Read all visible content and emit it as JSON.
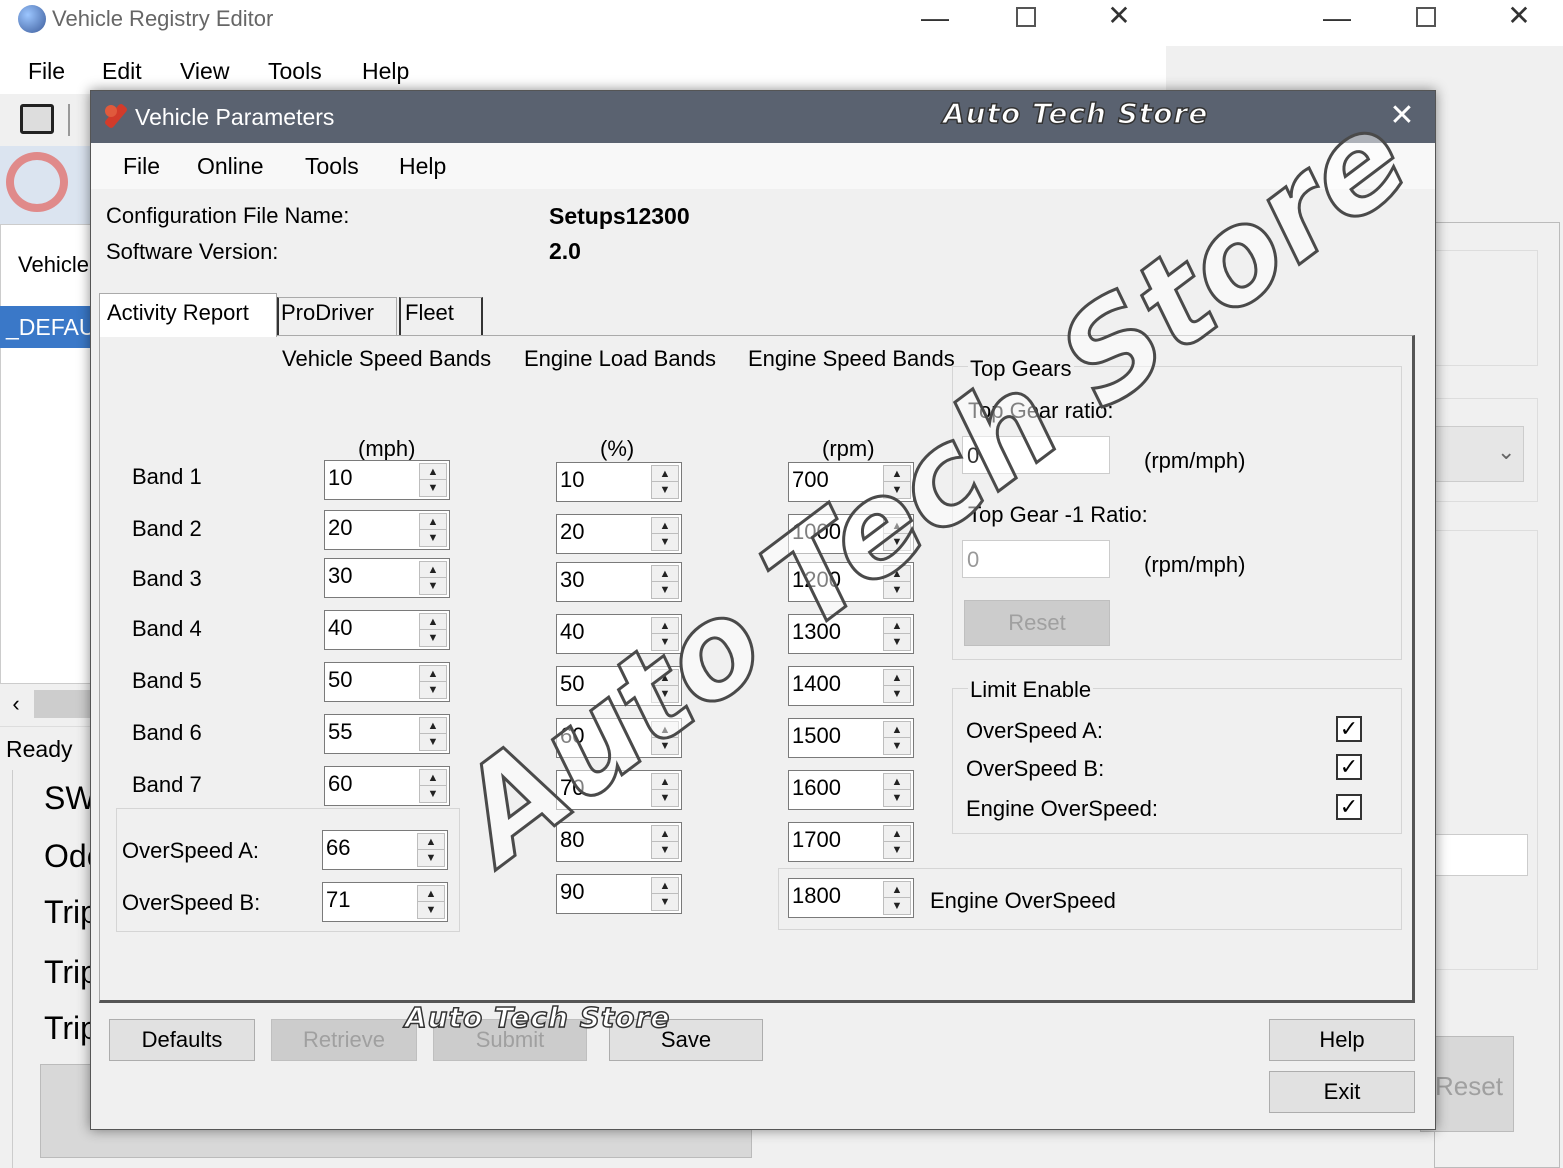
{
  "bg_window": {
    "title": "Vehicle Registry Editor",
    "menu": [
      "File",
      "Edit",
      "View",
      "Tools",
      "Help"
    ],
    "tab_label": "Vehicle",
    "selected_row": "_DEFAU",
    "status": "Ready",
    "left_labels": [
      "SW",
      "Odo",
      "Trip",
      "Trip",
      "Trip"
    ],
    "reset_label": "Reset"
  },
  "dialog": {
    "title": "Vehicle Parameters",
    "watermark": "Auto Tech Store",
    "menu": [
      "File",
      "Online",
      "Tools",
      "Help"
    ],
    "config_label": "Configuration File Name:",
    "config_value": "Setups12300",
    "software_label": "Software Version:",
    "software_value": "2.0",
    "tabs": [
      "Activity Report",
      "ProDriver",
      "Fleet"
    ],
    "headers": {
      "speed": "Vehicle Speed Bands",
      "load": "Engine Load Bands",
      "rpm": "Engine Speed Bands"
    },
    "units": {
      "speed": "(mph)",
      "load": "(%)",
      "rpm": "(rpm)"
    },
    "bands": [
      {
        "label": "Band 1",
        "speed": "10",
        "load": "10",
        "rpm": "700"
      },
      {
        "label": "Band 2",
        "speed": "20",
        "load": "20",
        "rpm": "1000"
      },
      {
        "label": "Band 3",
        "speed": "30",
        "load": "30",
        "rpm": "1200"
      },
      {
        "label": "Band 4",
        "speed": "40",
        "load": "40",
        "rpm": "1300"
      },
      {
        "label": "Band 5",
        "speed": "50",
        "load": "50",
        "rpm": "1400"
      },
      {
        "label": "Band 6",
        "speed": "55",
        "load": "60",
        "rpm": "1500"
      },
      {
        "label": "Band 7",
        "speed": "60",
        "load": "70",
        "rpm": "1600"
      }
    ],
    "extra_load": [
      "80",
      "90"
    ],
    "extra_rpm": "1700",
    "overspeed_a_label": "OverSpeed A:",
    "overspeed_a": "66",
    "overspeed_b_label": "OverSpeed B:",
    "overspeed_b": "71",
    "engine_overspeed_value": "1800",
    "engine_overspeed_label": "Engine OverSpeed",
    "top_gears": {
      "title": "Top Gears",
      "ratio_label": "Top Gear ratio:",
      "ratio_value": "0",
      "ratio_unit": "(rpm/mph)",
      "ratio1_label": "Top Gear -1 Ratio:",
      "ratio1_value": "0",
      "ratio1_unit": "(rpm/mph)",
      "reset": "Reset"
    },
    "limit_enable": {
      "title": "Limit Enable",
      "items": [
        {
          "label": "OverSpeed A:",
          "checked": true
        },
        {
          "label": "OverSpeed B:",
          "checked": true
        },
        {
          "label": "Engine OverSpeed:",
          "checked": true
        }
      ]
    },
    "buttons": {
      "defaults": "Defaults",
      "retrieve": "Retrieve",
      "submit": "Submit",
      "save": "Save",
      "help": "Help",
      "exit": "Exit"
    }
  }
}
